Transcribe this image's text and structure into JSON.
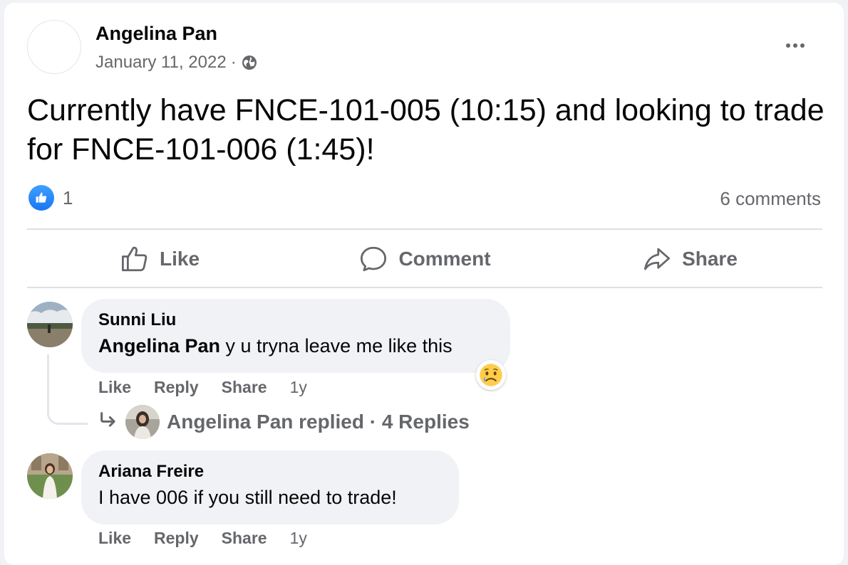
{
  "post": {
    "author": "Angelina Pan",
    "date": "January 11, 2022",
    "separator": "·",
    "privacy_icon": "globe-icon",
    "more_icon": "more-options-icon",
    "text": "Currently have FNCE-101-005 (10:15) and looking to trade for FNCE-101-006 (1:45)!",
    "like_count": "1",
    "comments_count": "6 comments"
  },
  "actions": {
    "like": "Like",
    "comment": "Comment",
    "share": "Share"
  },
  "comments": [
    {
      "author": "Sunni Liu",
      "mention": "Angelina Pan",
      "text": " y u tryna leave me like this",
      "reaction_icon": "sad-tear-emoji-icon",
      "like": "Like",
      "reply": "Reply",
      "share": "Share",
      "time": "1y",
      "replies_text": "Angelina Pan replied · 4 Replies"
    },
    {
      "author": "Ariana Freire",
      "text": "I have 006 if you still need to trade!",
      "like": "Like",
      "reply": "Reply",
      "share": "Share",
      "time": "1y"
    }
  ],
  "colors": {
    "accent": "#1877f2",
    "secondary_text": "#65676b",
    "bubble": "#f0f2f5"
  }
}
